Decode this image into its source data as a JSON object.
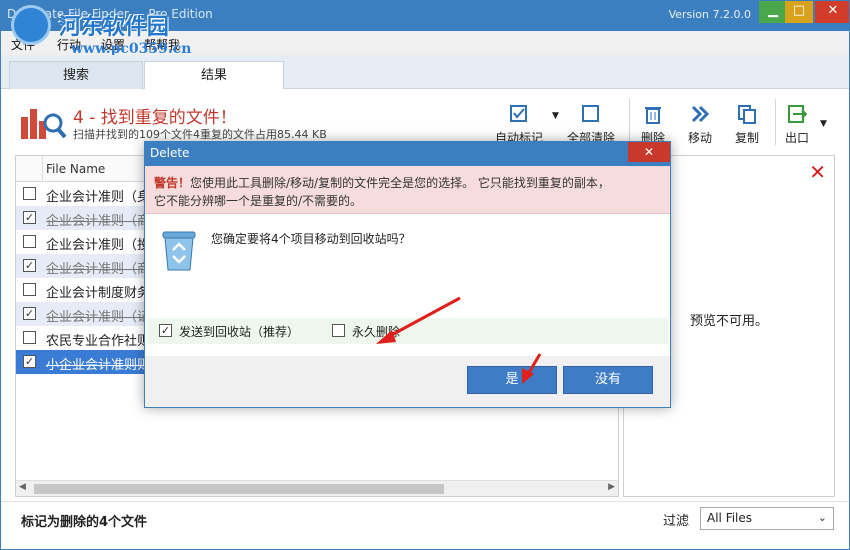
{
  "window": {
    "title": "Duplicate File Finder — Pro Edition",
    "version": "Version 7.2.0.0",
    "controls": {
      "minimize": "▁",
      "maximize": "□",
      "close": "✕"
    }
  },
  "watermark": {
    "text": "河东软件园",
    "url": "www.pc0359.cn"
  },
  "menu": [
    "文件",
    "行动",
    "设置",
    "帮帮我"
  ],
  "tabs": {
    "search": "搜索",
    "results": "结果"
  },
  "header": {
    "title": "4 - 找到重复的文件！",
    "subtitle": "扫描并找到的109个文件4重复的文件占用85.44 KB"
  },
  "toolbar": {
    "auto_mark": "自动标记",
    "clear_all": "全部清除",
    "delete": "删除",
    "move": "移动",
    "copy": "复制",
    "export": "出口"
  },
  "file_list": {
    "column": "File Name",
    "rows": [
      {
        "name": "企业会计准则（身",
        "checked": false,
        "strike": false
      },
      {
        "name": "企业会计准则（商",
        "checked": true,
        "strike": true
      },
      {
        "name": "企业会计准则（投",
        "checked": false,
        "strike": false
      },
      {
        "name": "企业会计准则（商",
        "checked": true,
        "strike": true
      },
      {
        "name": "企业会计制度财务",
        "checked": false,
        "strike": false
      },
      {
        "name": "企业会计准则（证",
        "checked": true,
        "strike": true
      },
      {
        "name": "农民专业合作社则",
        "checked": false,
        "strike": false
      },
      {
        "name": "小企业会计准则则",
        "checked": true,
        "strike": true
      }
    ]
  },
  "preview": {
    "unavailable": "预览不可用。",
    "close": "✕"
  },
  "status": {
    "marked": "标记为删除的4个文件"
  },
  "filter": {
    "label": "过滤",
    "value": "All Files"
  },
  "dialog": {
    "title": "Delete",
    "close": "✕",
    "warning_label": "警告！",
    "warning_line1": "您使用此工具删除/移动/复制的文件完全是您的选择。 它只能找到重复的副本，",
    "warning_line2": "它不能分辨哪一个是重复的/不需要的。",
    "question": "您确定要将4个项目移动到回收站吗？",
    "opt_recycle": "发送到回收站（推荐）",
    "opt_recycle_checked": true,
    "opt_permanent": "永久删除",
    "opt_permanent_checked": false,
    "yes": "是",
    "no": "没有"
  },
  "colors": {
    "titlebar": "#3c7fc0",
    "accent_red": "#c0392b",
    "selected_row": "#3a7bd5",
    "alt_row": "#e6ebf5",
    "warning_bg": "#f6dcdc",
    "button": "#3e7dc5",
    "arrow": "#e0201a"
  }
}
